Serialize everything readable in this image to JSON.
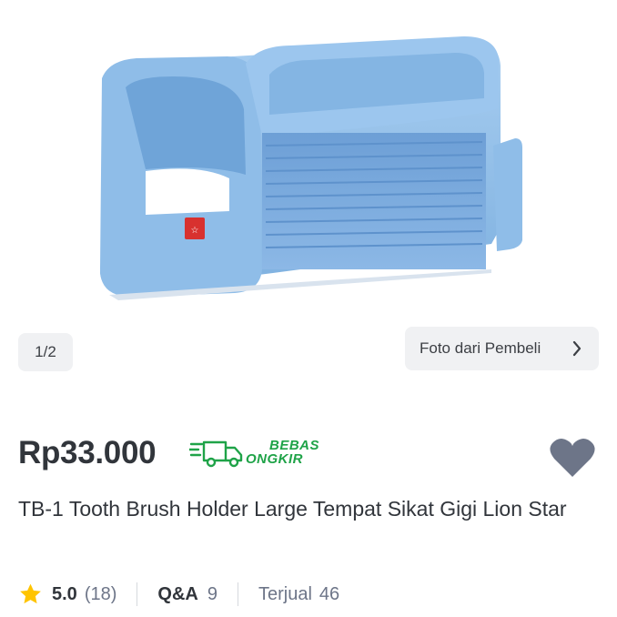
{
  "gallery": {
    "pager_text": "1/2",
    "buyer_photo_label": "Foto dari Pembeli"
  },
  "product": {
    "price": "Rp33.000",
    "shipping_badge": {
      "line1": "BEBAS",
      "line2": "ONGKIR"
    },
    "title": "TB-1 Tooth Brush Holder Large Tempat Sikat Gigi Lion Star"
  },
  "stats": {
    "rating": "5.0",
    "review_count": "(18)",
    "qa_label": "Q&A",
    "qa_count": "9",
    "sold_label": "Terjual",
    "sold_count": "46"
  },
  "colors": {
    "text": "#31353b",
    "muted": "#6d7588",
    "badge_green": "#1fa348",
    "star": "#ffc400",
    "heart": "#6d7588",
    "product_blue": "#8ab8e4"
  },
  "icons": [
    "chevron-right-icon",
    "free-shipping-truck-icon",
    "heart-icon",
    "star-icon"
  ]
}
